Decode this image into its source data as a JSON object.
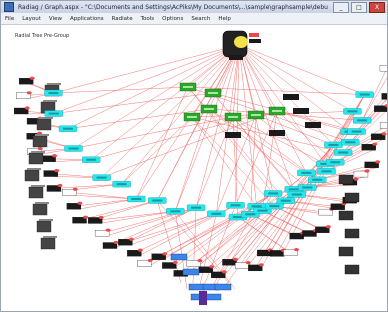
{
  "window": {
    "title": "Radiag / Graph.aspx - \"C:\\Documents and Settings\\AcPiks\\My Documents\\...\\sample\\graphsample\\debug\\Graph.aspx\" [FIT SIZE]",
    "buttons": [
      "_",
      "□",
      "X"
    ]
  },
  "menubar": {
    "items": [
      "File",
      "Layout",
      "View",
      "Applications",
      "Radiate",
      "Tools",
      "Options",
      "Search",
      "Help"
    ]
  },
  "canvas": {
    "caption": "Radial Tree Pre-Group"
  },
  "colors": {
    "edge": "#f04848",
    "cyan_node": "#26e6ee",
    "green_node": "#2aa82a",
    "dark_node": "#1a1a1a",
    "root_yellow": "#f2e24a",
    "blue_node": "#3b86e8"
  }
}
